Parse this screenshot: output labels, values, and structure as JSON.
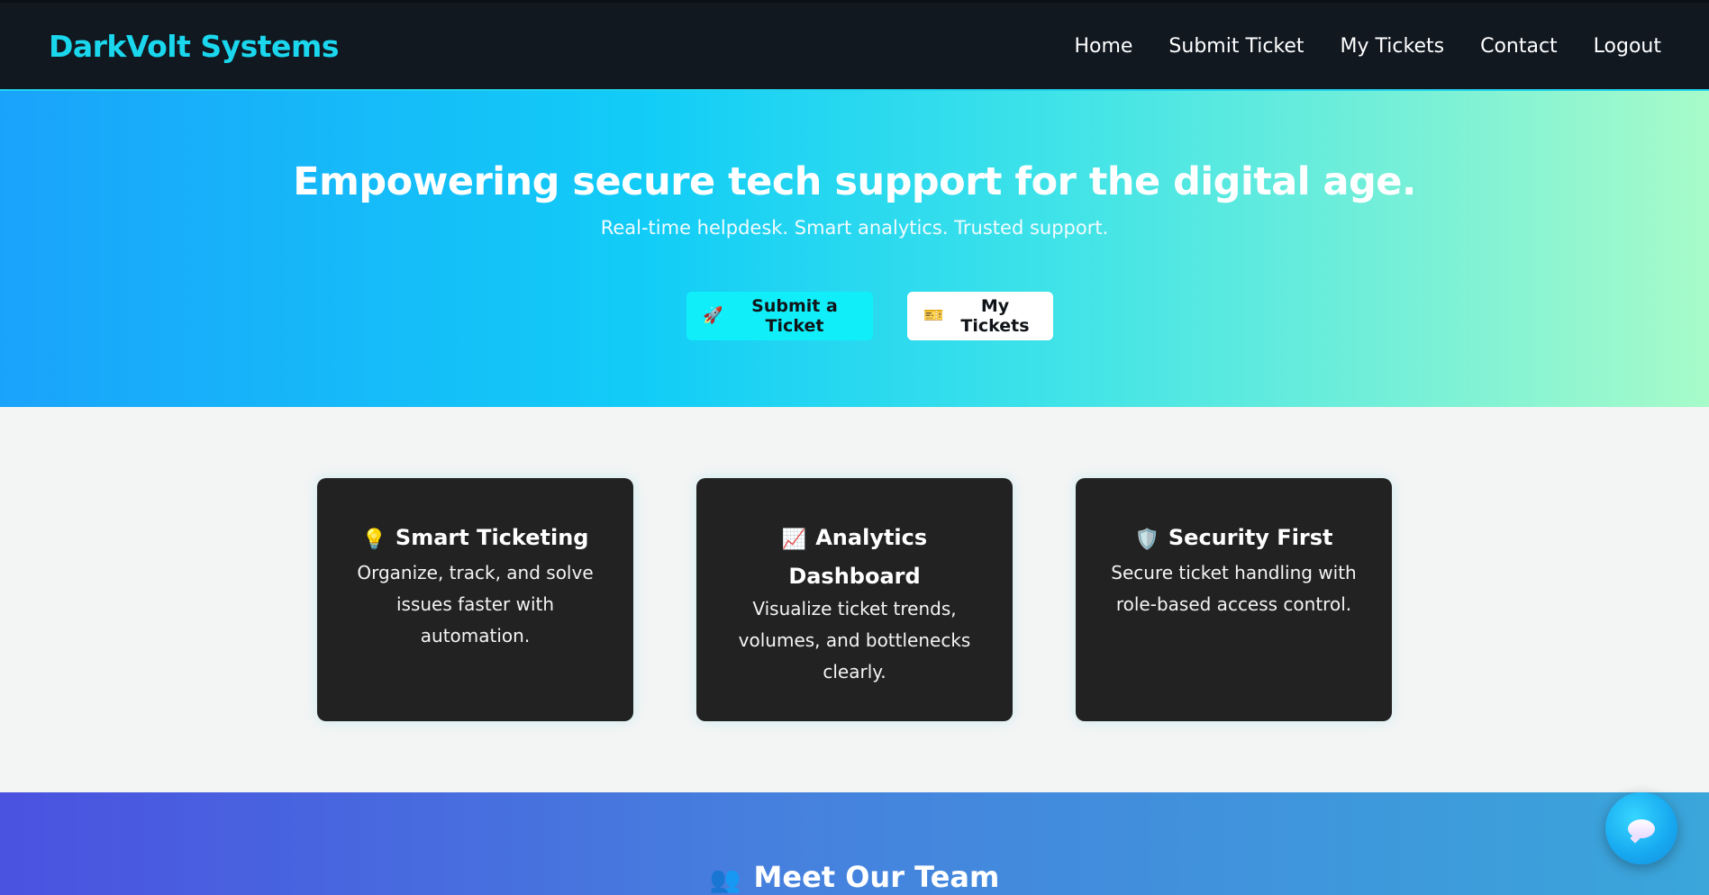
{
  "navbar": {
    "brand": "DarkVolt Systems",
    "links": [
      "Home",
      "Submit Ticket",
      "My Tickets",
      "Contact",
      "Logout"
    ]
  },
  "hero": {
    "title": "Empowering secure tech support for the digital age.",
    "subtitle": "Real-time helpdesk. Smart analytics. Trusted support.",
    "primary_button": {
      "icon": "🚀",
      "icon_name": "rocket-icon",
      "label": "Submit a Ticket"
    },
    "secondary_button": {
      "icon": "🎫",
      "icon_name": "ticket-icon",
      "label": "My Tickets"
    }
  },
  "features": [
    {
      "icon": "💡",
      "icon_name": "lightbulb-icon",
      "title": "Smart Ticketing",
      "text": "Organize, track, and solve issues faster with automation."
    },
    {
      "icon": "📈",
      "icon_name": "chart-increasing-icon",
      "title": "Analytics Dashboard",
      "text": "Visualize ticket trends, volumes, and bottlenecks clearly."
    },
    {
      "icon": "🛡️",
      "icon_name": "shield-icon",
      "title": "Security First",
      "text": "Secure ticket handling with role-based access control."
    }
  ],
  "team": {
    "icon": "👥",
    "icon_name": "people-icon",
    "title": "Meet Our Team"
  },
  "chat": {
    "icon_name": "chat-bubble-icon"
  },
  "colors": {
    "navbar_bg": "#111820",
    "brand_accent": "#1ad7ee",
    "primary_button": "#10eef9",
    "card_bg": "#222222",
    "page_bg": "#f3f4f4"
  }
}
